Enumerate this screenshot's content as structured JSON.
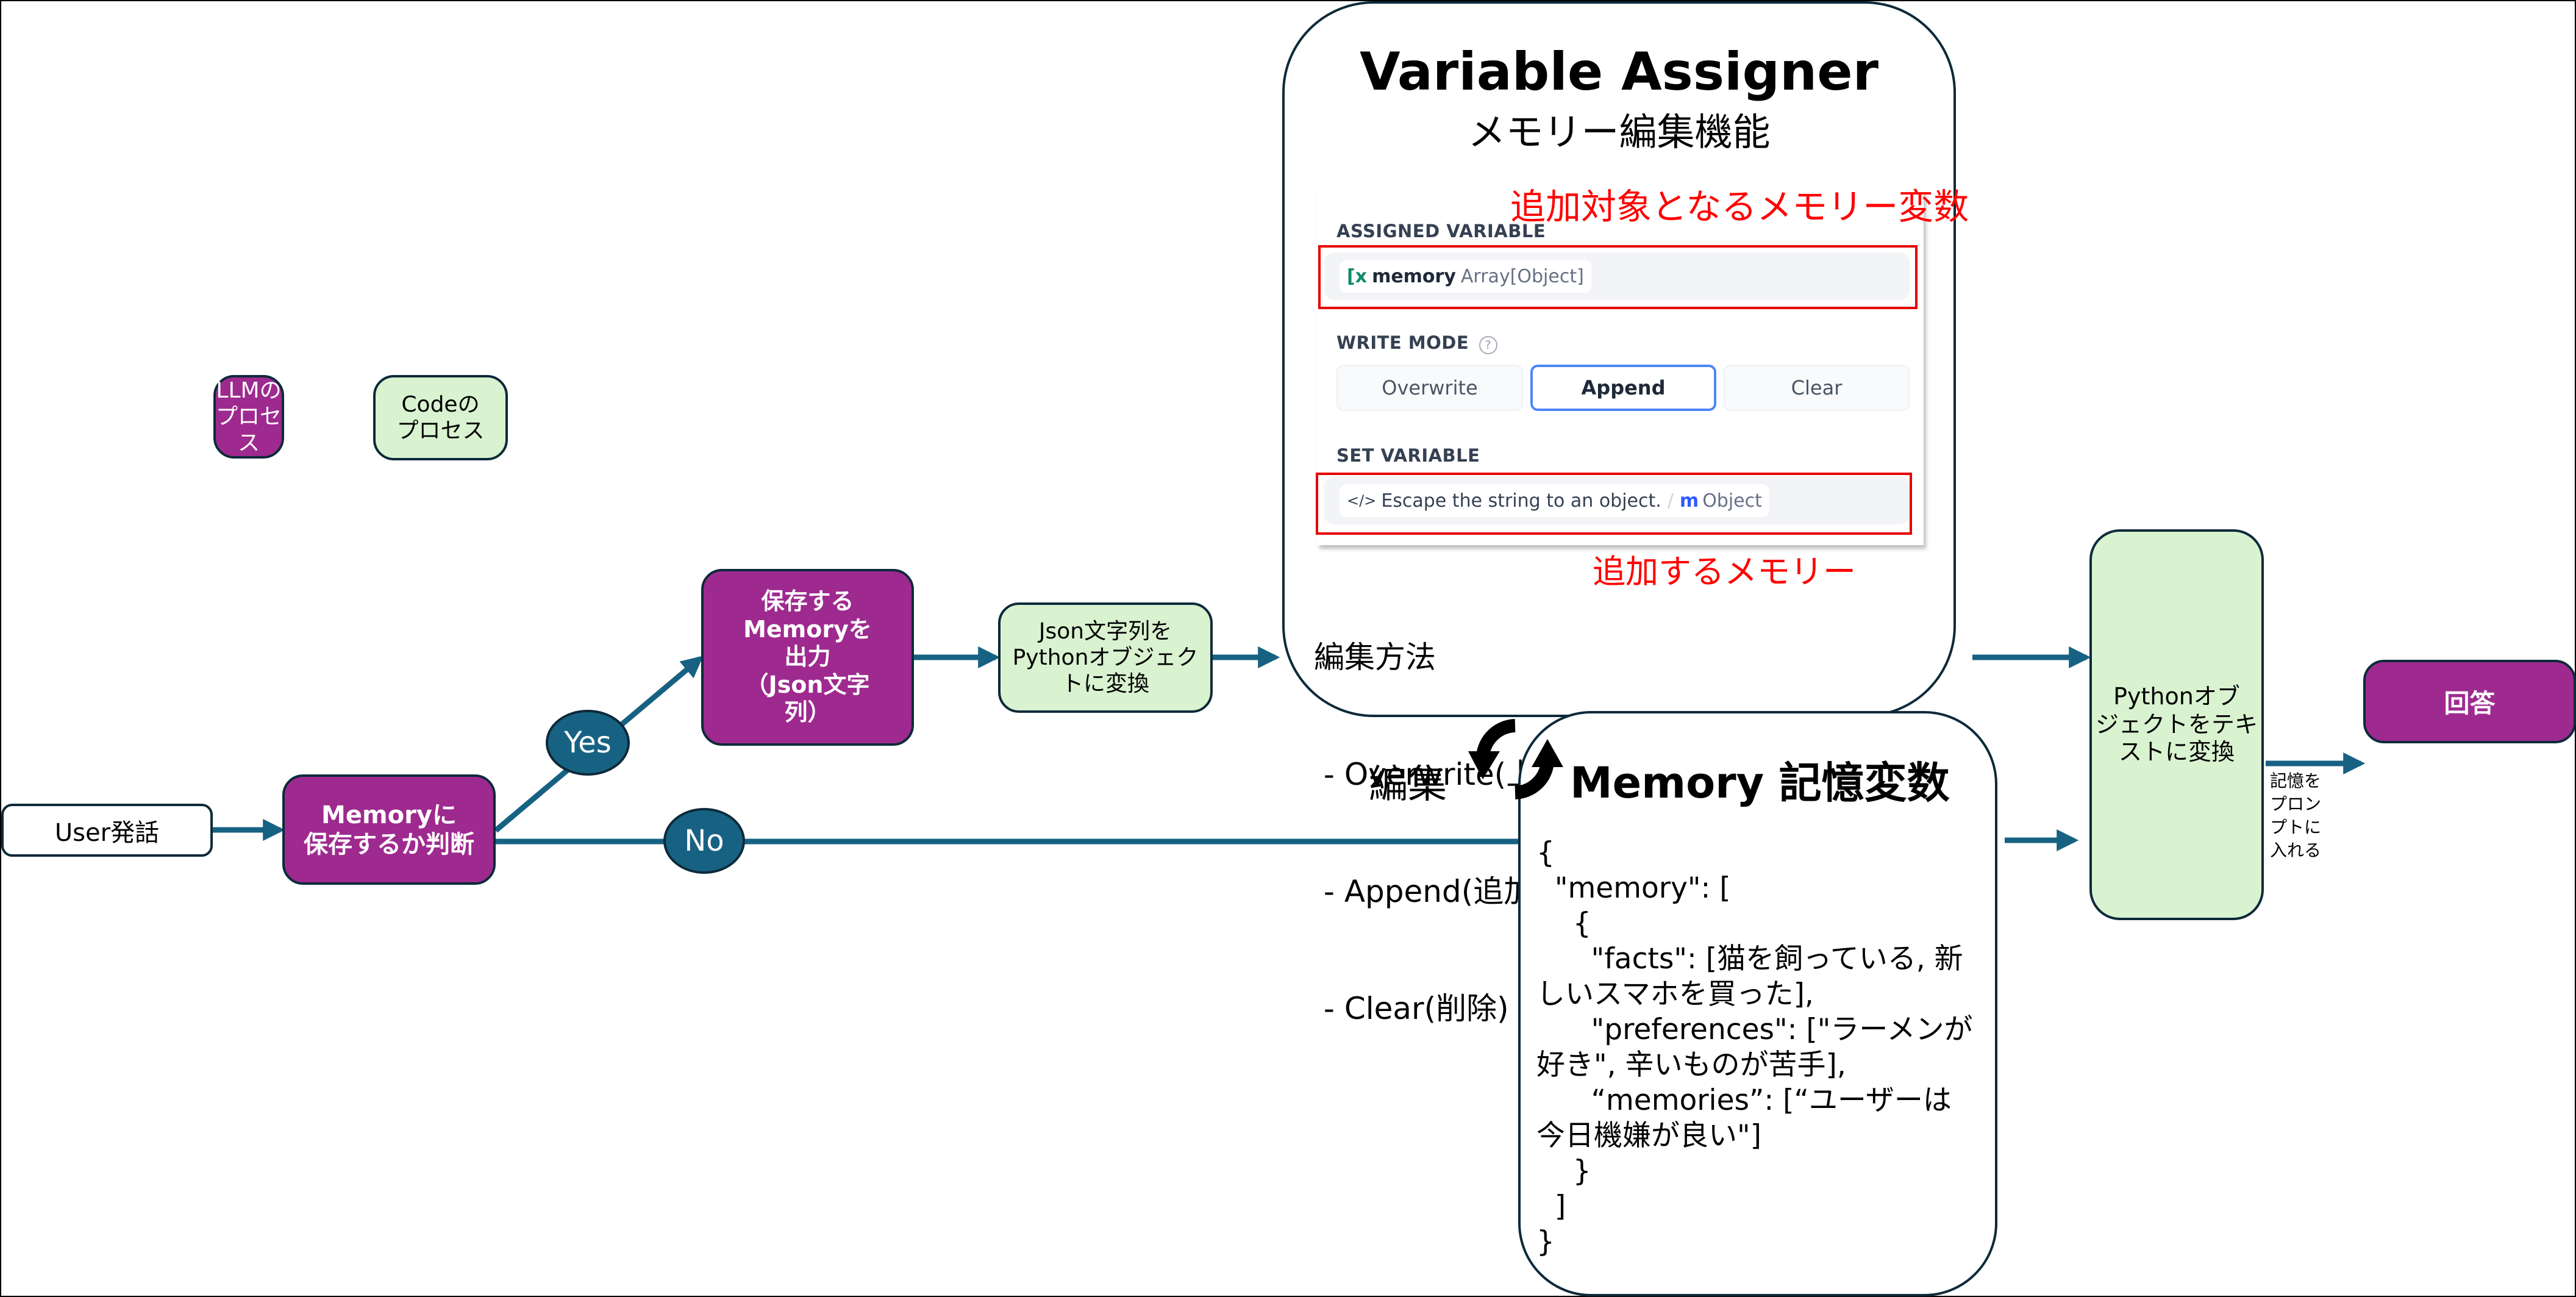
{
  "legend": {
    "llm_label": "LLMの\nプロセス",
    "code_label": "Codeの\nプロセス"
  },
  "colors": {
    "llm_process": "#9e2a8f",
    "code_process": "#d9f2d0",
    "connector": "#176283",
    "annotation_red": "#ff0000",
    "append_active_border": "#4f86f7"
  },
  "flow": {
    "user_input": "User発話",
    "judge": "Memoryに\n保存するか判断",
    "yes": "Yes",
    "no": "No",
    "output_memory": "保存する\nMemoryを\n出力\n（Json文字\n列）",
    "json_to_python": "Json文字列を\nPythonオブジェク\nトに変換",
    "python_to_text": "Pythonオブ\nジェクトをテキ\nストに変換",
    "prompt_note": "記憶を\nプロンプトに\n入れる",
    "answer": "回答"
  },
  "variable_assigner": {
    "title": "Variable Assigner",
    "subtitle": "メモリー編集機能",
    "note_target": "追加対象となるメモリー変数",
    "note_value": "追加するメモリー",
    "assigned_variable": {
      "label": "ASSIGNED VARIABLE",
      "icon": "variable-icon",
      "name": "memory",
      "type": "Array[Object]"
    },
    "write_mode": {
      "label": "WRITE MODE",
      "help_icon": "help-circle-icon",
      "options": [
        "Overwrite",
        "Append",
        "Clear"
      ],
      "selected": "Append"
    },
    "set_variable": {
      "label": "SET VARIABLE",
      "icon": "code-icon",
      "source": "Escape the string to an object.",
      "separator": "/",
      "type_icon": "object-icon",
      "type": "Object"
    },
    "methods_title": "編集方法",
    "methods": [
      " - Overwrite(上書き)",
      " - Append(追加)※array[object]のみ有効",
      " - Clear(削除)"
    ]
  },
  "edit_label": "編集",
  "memory_variable": {
    "title": "Memory 記憶変数",
    "json_lines": [
      "{",
      "  \"memory\": [",
      "    {",
      "      \"facts\": [猫を飼っている, 新しいスマホを買った],",
      "      \"preferences\": [\"ラーメンが好き\", 辛いものが苦手],",
      "      “memories”: [“ユーザーは今日機嫌が良い\"]",
      "    }",
      "  ]",
      "}"
    ]
  }
}
